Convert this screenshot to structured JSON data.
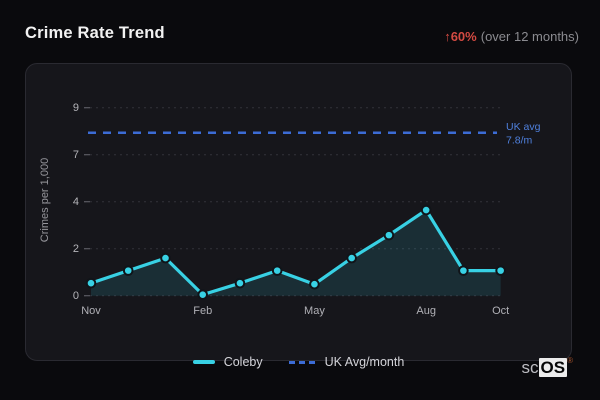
{
  "header": {
    "title": "Crime Rate Trend",
    "trend": {
      "arrow": "↑",
      "value": "60%",
      "caption": "(over 12 months)"
    }
  },
  "chart_data": {
    "type": "line",
    "title": "Crime Rate Trend",
    "ylabel": "Crimes per 1,000",
    "ylim": [
      0,
      9
    ],
    "y_ticks": [
      0,
      2,
      4,
      7,
      9
    ],
    "grid": true,
    "x_point_count": 12,
    "x_labels": [
      {
        "index": 0,
        "label": "Nov"
      },
      {
        "index": 3,
        "label": "Feb"
      },
      {
        "index": 6,
        "label": "May"
      },
      {
        "index": 9,
        "label": "Aug"
      },
      {
        "index": 11,
        "label": "Oct"
      }
    ],
    "series": [
      {
        "name": "Coleby",
        "type": "line",
        "color": "#38d1e4",
        "area_fill": true,
        "values": [
          0.6,
          1.2,
          1.8,
          0.05,
          0.6,
          1.2,
          0.55,
          1.8,
          2.9,
          4.1,
          1.2,
          1.2
        ]
      },
      {
        "name": "UK Avg/month",
        "type": "reference-line",
        "style": "dashed",
        "color": "#3c6cd6",
        "value": 7.8,
        "annotation": [
          "UK avg",
          "7.8/m"
        ]
      }
    ],
    "legend_position": "bottom"
  },
  "legend": {
    "items": [
      {
        "label": "Coleby",
        "swatch": "solid-cyan"
      },
      {
        "label": "UK Avg/month",
        "swatch": "dashed-blue"
      }
    ]
  },
  "branding": {
    "text_prefix": "sc",
    "text_boxed": "OS",
    "registered_mark": "®"
  },
  "colors": {
    "accent_cyan": "#38d1e4",
    "reference_blue": "#3c6cd6",
    "negative_red": "#d24a42",
    "card_background": "#16161b",
    "page_background": "#0a0a0d"
  }
}
